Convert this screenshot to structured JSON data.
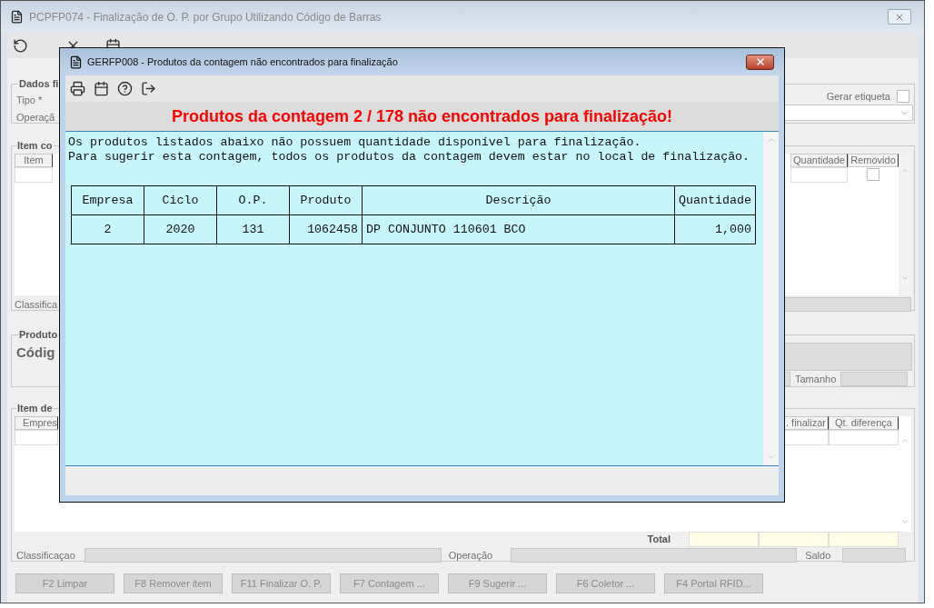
{
  "main_window": {
    "title": "PCPFP074 - Finalização de O. P.  por Grupo Utilizando Código de Barras"
  },
  "dados_group": {
    "title": "Dados fi",
    "labels": [
      "Tipo *",
      "Operaçã"
    ],
    "gerar_etiqueta": {
      "label": "Gerar etiqueta",
      "checked": false
    }
  },
  "item_group": {
    "title": "Item co",
    "left_column": "Item",
    "right_columns": [
      "Quantidade",
      "Removido"
    ],
    "row_removido_checked": false,
    "footer_label": "Classifica"
  },
  "produto_group": {
    "title": "Produto",
    "code_label": "Códig",
    "size_label": "Tamanho"
  },
  "item_de_group": {
    "title": "Item de",
    "left_column": "Empres",
    "right_columns": [
      ". finalizar",
      "Qt. diferença"
    ],
    "total_label": "Total",
    "footer": [
      {
        "label": "Classificaçao"
      },
      {
        "label": "Operação"
      },
      {
        "label": "Saldo"
      }
    ]
  },
  "buttons": [
    {
      "label": "F2 Limpar",
      "disabled": true
    },
    {
      "label": "F8 Remover item",
      "disabled": true
    },
    {
      "label": "F11 Finalizar O. P.",
      "disabled": true
    },
    {
      "label": "F7 Contagem ...",
      "disabled": true
    },
    {
      "label": "F9 Sugerir ...",
      "disabled": true
    },
    {
      "label": "F6 Coletor ...",
      "disabled": true
    },
    {
      "label": "F4 Portal RFID...",
      "disabled": true
    }
  ],
  "dialog": {
    "title": "GERFP008 - Produtos da contagem não encontrados para finalização",
    "heading": "Produtos da contagem 2 / 178 não encontrados para finalização!",
    "message_lines": [
      "Os produtos listados abaixo não possuem quantidade disponível para finalização.",
      "Para sugerir esta contagem, todos os produtos da contagem devem estar no local de finalização."
    ],
    "table": {
      "columns": [
        "Empresa",
        "Ciclo",
        "O.P.",
        "Produto",
        "Descrição",
        "Quantidade"
      ],
      "rows": [
        [
          "2",
          "2020",
          "131",
          "1062458",
          "DP CONJUNTO 110601 BCO",
          "1,000"
        ]
      ]
    }
  }
}
